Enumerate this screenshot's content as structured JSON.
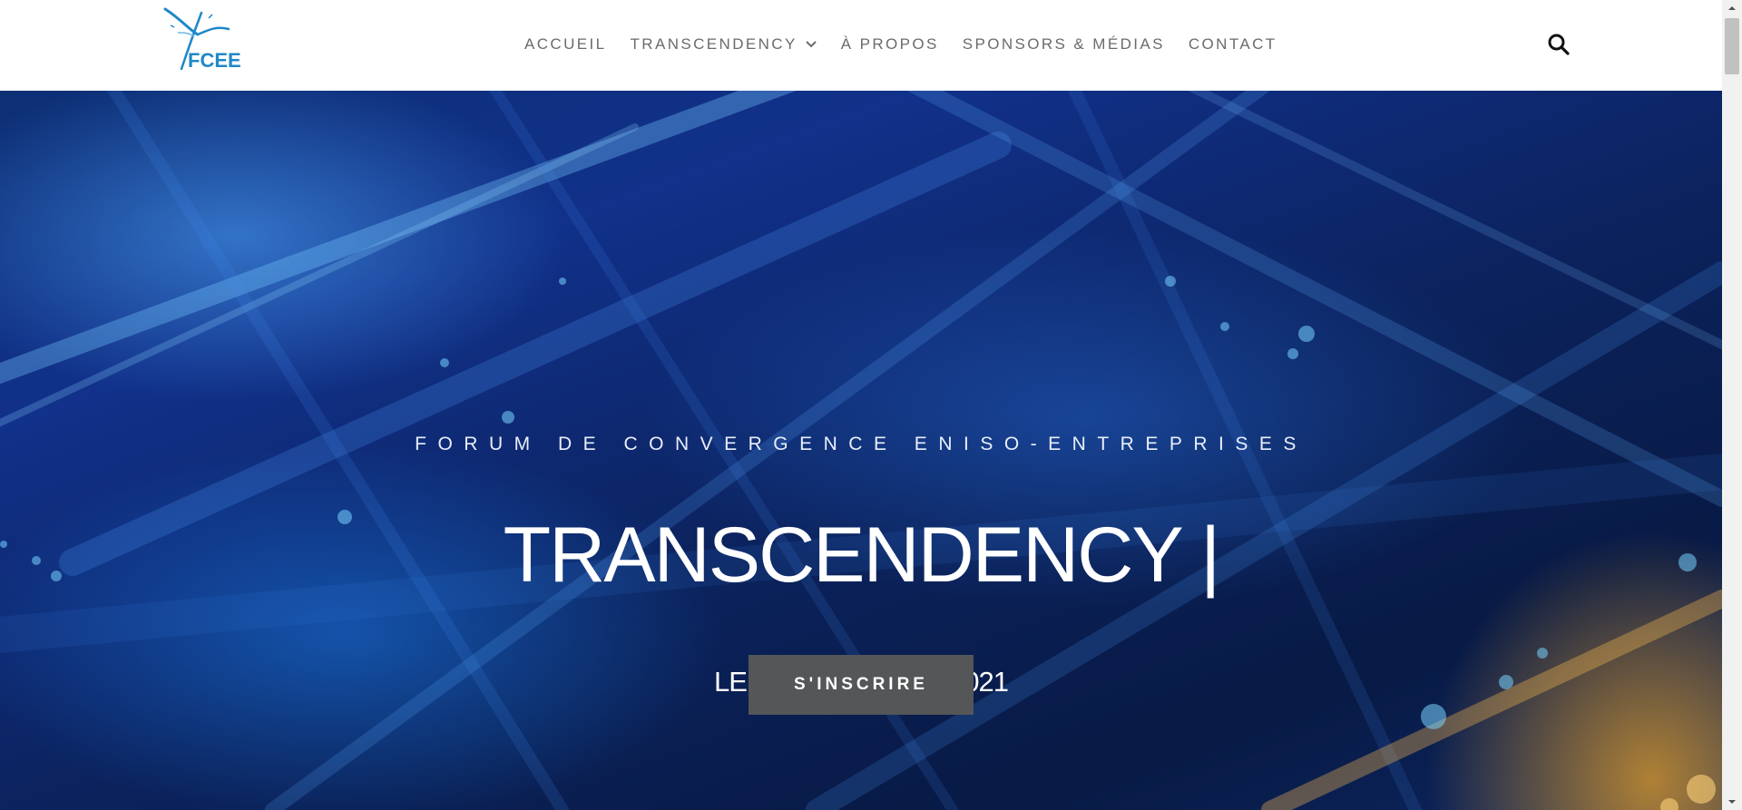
{
  "header": {
    "logo_text": "FCEE",
    "nav": [
      {
        "label": "ACCUEIL",
        "has_dropdown": false
      },
      {
        "label": "TRANSCENDENCY",
        "has_dropdown": true
      },
      {
        "label": "À PROPOS",
        "has_dropdown": false
      },
      {
        "label": "SPONSORS & MÉDIAS",
        "has_dropdown": false
      },
      {
        "label": "CONTACT",
        "has_dropdown": false
      }
    ],
    "search_icon": "search-icon"
  },
  "hero": {
    "eyebrow": "FORUM DE CONVERGENCE ENISO-ENTREPRISES",
    "title": "TRANSCENDENCY |",
    "date": "LE 01 DÉCEMBRE 2021",
    "cta_label": "S'INSCRIRE"
  },
  "colors": {
    "logo_blue": "#1e88c9",
    "nav_text": "#6b6b6b",
    "hero_dark": "#0b225c",
    "cta_bg": "#545658"
  }
}
